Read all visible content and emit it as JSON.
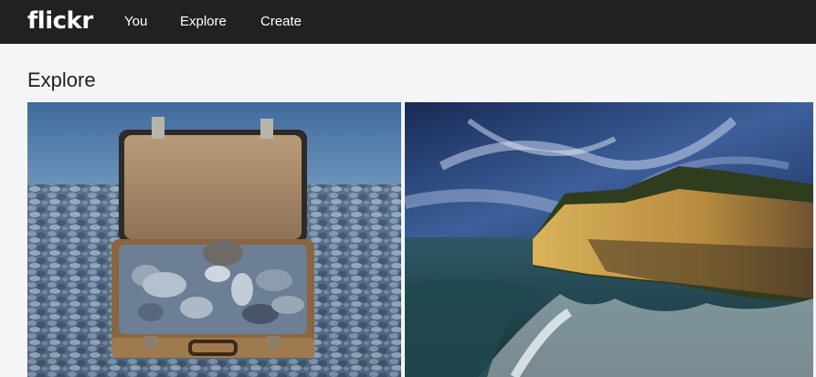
{
  "header": {
    "logo": "flickr",
    "nav": {
      "you": "You",
      "explore": "Explore",
      "create": "Create"
    }
  },
  "page": {
    "title": "Explore"
  },
  "photos": [
    {
      "subject": "open suitcase filled with pebbles on a pebble beach by the sea"
    },
    {
      "subject": "sunlit yellow sea cliff with trees and crashing waves under a dramatic sky"
    }
  ],
  "colors": {
    "topbar": "#212124",
    "background": "#f3f5f6",
    "text": "#212124"
  }
}
